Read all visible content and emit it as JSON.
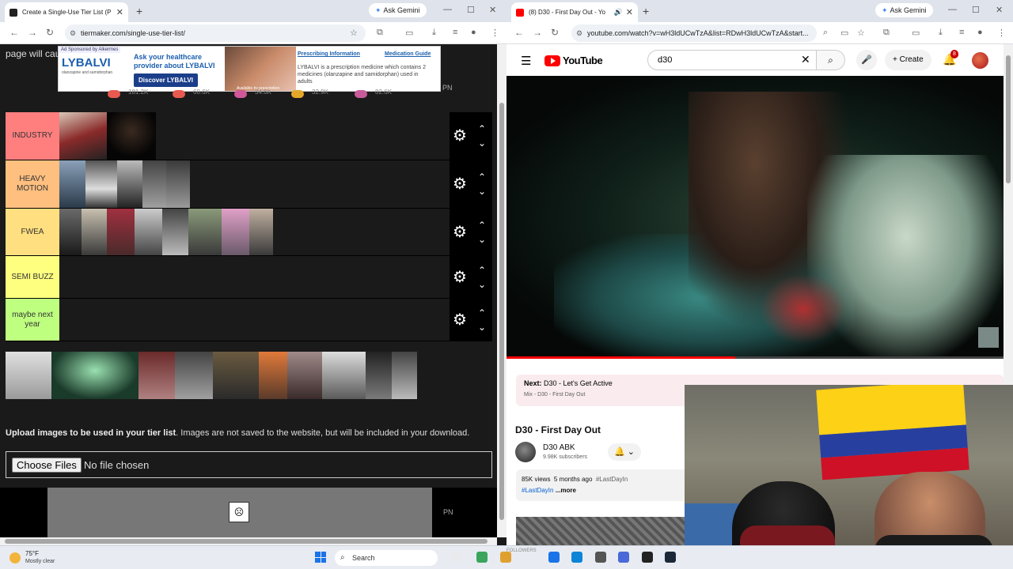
{
  "left_window": {
    "tab_title": "Create a Single-Use Tier List (P",
    "gemini_label": "Ask Gemini",
    "url": "tiermaker.com/single-use-tier-list/",
    "page_caution_text": "page will cau",
    "ad": {
      "tag": "Ad Sponsored by Alkermes",
      "brand": "LYBALVI",
      "brand_sub": "olanzapine and samidorphan",
      "headline": "Ask your healthcare provider about LYBALVI",
      "cta": "Discover LYBALVI",
      "prescribing_info": "Prescribing Information",
      "medication_guide": "Medication Guide",
      "body": "LYBALVI is a prescription medicine which contains 2 medicines (olanzapine and samidorphan) used in adults",
      "available": "Available by prescription"
    },
    "pn_label": "PN",
    "reaction_counts": [
      "181.2K",
      "60.6K",
      "34.6K",
      "32.9K",
      "82.6K"
    ],
    "tiers": [
      {
        "label": "INDUSTRY",
        "color": "#ff7f7f"
      },
      {
        "label": "HEAVY MOTION",
        "color": "#ffbf7f"
      },
      {
        "label": "FWEA",
        "color": "#ffdf7f"
      },
      {
        "label": "SEMI BUZZ",
        "color": "#ffff7f"
      },
      {
        "label": "maybe next year",
        "color": "#bfff7f"
      }
    ],
    "upload_bold": "Upload images to be used in your tier list",
    "upload_rest": ". Images are not saved to the website, but will be included in your download.",
    "file_button": "Choose Files",
    "file_status": "No file chosen"
  },
  "right_window": {
    "tab_title": "(8) D30 - First Day Out - Yo",
    "gemini_label": "Ask Gemini",
    "url": "youtube.com/watch?v=wH3ldUCwTzA&list=RDwH3ldUCwTzA&start...",
    "yt_word": "YouTube",
    "search_query": "d30",
    "create_label": "Create",
    "notif_count": "8",
    "next_label": "Next:",
    "next_title": "D30 - Let's Get Active",
    "next_sub": "Mix - D30 - First Day Out",
    "video_title": "D30 - First Day Out",
    "channel_name": "D30 ABK",
    "channel_subs": "9.98K subscribers",
    "views": "85K views",
    "age": "5 months ago",
    "hashtag1": "#LastDayIn",
    "hashtag2": "#LastDayIn",
    "more_label": "...more",
    "progress": 0.46
  },
  "taskbar": {
    "temp": "75°F",
    "condition": "Mostly clear",
    "search_label": "Search",
    "followers_text": "FOLLOWERS"
  }
}
